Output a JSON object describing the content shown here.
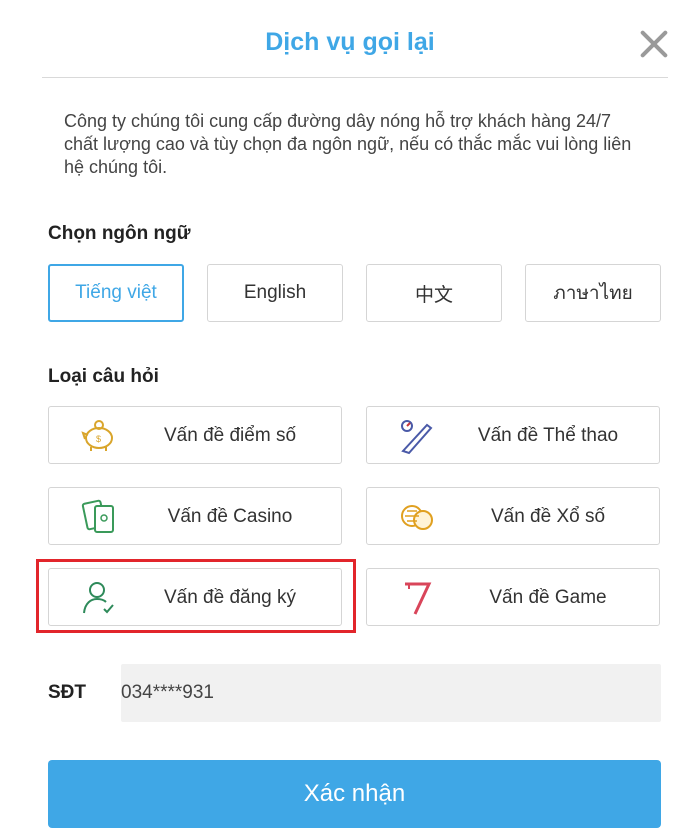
{
  "header": {
    "title": "Dịch vụ gọi lại",
    "close_icon": "close-icon"
  },
  "description": "Công ty chúng tôi cung cấp đường dây nóng hỗ trợ khách hàng 24/7 chất lượng cao và tùy chọn đa ngôn ngữ, nếu có thắc mắc vui lòng liên hệ chúng tôi.",
  "language": {
    "label": "Chọn ngôn ngữ",
    "options": [
      "Tiếng việt",
      "English",
      "中文",
      "ภาษาไทย"
    ],
    "selected": "Tiếng việt",
    "accent_color": "#3fa7e6"
  },
  "question_type": {
    "label": "Loại câu hỏi",
    "options": [
      {
        "label": "Vấn đề điểm số",
        "icon": "piggy-bank-icon"
      },
      {
        "label": "Vấn đề Thể thao",
        "icon": "baseball-bat-icon"
      },
      {
        "label": "Vấn đề Casino",
        "icon": "playing-cards-icon"
      },
      {
        "label": "Vấn đề Xổ số",
        "icon": "lottery-coins-icon"
      },
      {
        "label": "Vấn đề đăng ký",
        "icon": "user-check-icon"
      },
      {
        "label": "Vấn đề Game",
        "icon": "slot-seven-icon"
      }
    ],
    "highlighted": "Vấn đề đăng ký",
    "highlight_color": "#e2252b"
  },
  "phone": {
    "label": "SĐT",
    "value": "034****931"
  },
  "submit": {
    "label": "Xác nhận",
    "color": "#3fa7e6"
  }
}
